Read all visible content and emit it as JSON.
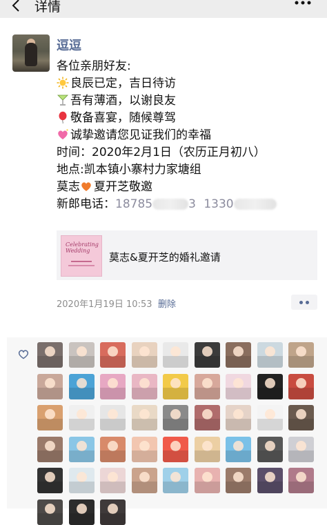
{
  "header": {
    "title": "详情"
  },
  "post": {
    "author": "逗逗",
    "lines": [
      {
        "icon": "",
        "text": "各位亲朋好友:"
      },
      {
        "icon": "sun-emoji-icon",
        "text": "良辰已定，吉日待访"
      },
      {
        "icon": "cocktail-emoji-icon",
        "text": "吾有薄酒，以谢良友"
      },
      {
        "icon": "balloon-emoji-icon",
        "text": "敬备喜宴，随候尊驾"
      },
      {
        "icon": "sparkling-heart-emoji-icon",
        "text": "诚挚邀请您见证我们的幸福"
      },
      {
        "icon": "",
        "text": "时间：2020年2月1日（农历正月初八）"
      },
      {
        "icon": "",
        "text": "地点:凯本镇小寨村力家塘组"
      }
    ],
    "names_left": "莫志",
    "names_right": "夏开芝敬邀",
    "phone_label": "新郎电话：",
    "phone_1_visible_start": "18785",
    "phone_1_visible_end": "3",
    "phone_2_visible_start": "1330",
    "link": {
      "thumb_text": "Celebrating Wedding",
      "title": "莫志&夏开芝的婚礼邀请"
    },
    "timestamp": "2020年1月19日 10:53",
    "delete_label": "删除"
  },
  "likes": {
    "icon": "heart-outline-icon",
    "avatar_colors": [
      "#7a6f6c",
      "#c9c3bf",
      "#d86c5d",
      "#e8d2bf",
      "#e9e9e9",
      "#3b3b3b",
      "#8a6e5e",
      "#ccd9e0",
      "#bfa48a",
      "#c9a89a",
      "#4ca3d6",
      "#e7a8c3",
      "#e9b7c4",
      "#f2ca49",
      "#d7a89b",
      "#f0d8e0",
      "#222222",
      "#c84c40",
      "#d9a06f",
      "#f0f0f0",
      "#e6e6e6",
      "#e9d9c6",
      "#8a8a8a",
      "#b06c6c",
      "#e5d3c8",
      "#f4f4f4",
      "#6a5a4e",
      "#9a7a6a",
      "#8ac6e6",
      "#d88a6a",
      "#f2c6b0",
      "#f05a4a",
      "#eccfa3",
      "#7ac1e8",
      "#585858",
      "#cfcfd4",
      "#333333",
      "#dfe9ee",
      "#ecd6d6",
      "#caa38c",
      "#9fd0e9",
      "#e8b2b0",
      "#9b7b6a",
      "#5b4f6a",
      "#b07a8a",
      "#4d4a48",
      "#2c2c2c",
      "#3f3a3a"
    ]
  }
}
